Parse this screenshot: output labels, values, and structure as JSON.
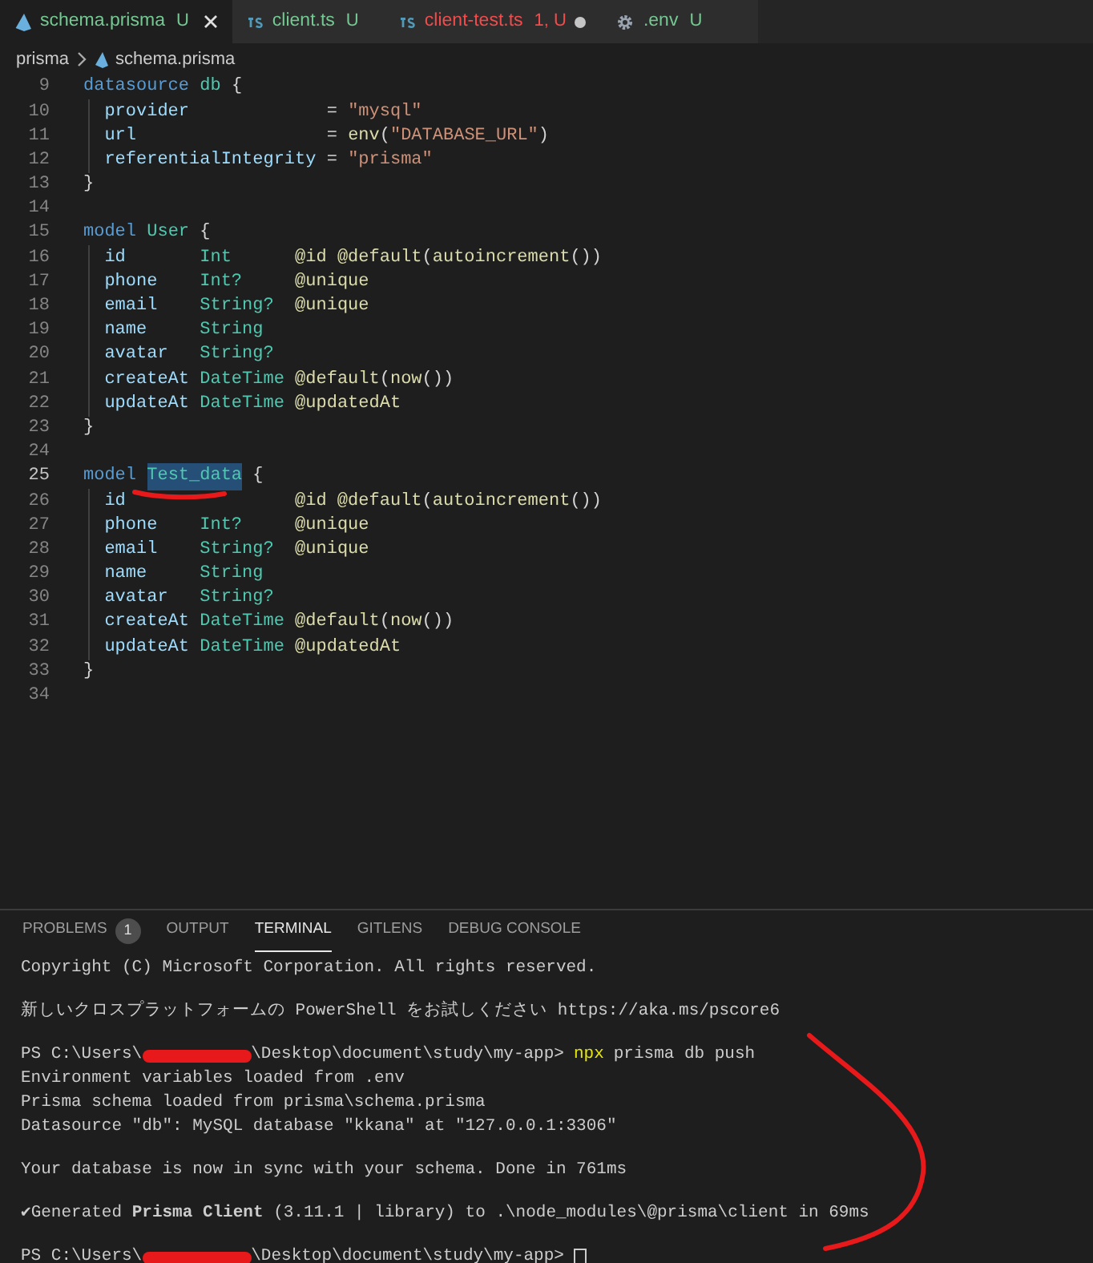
{
  "tabs": [
    {
      "label": "schema.prisma",
      "kind": "prisma",
      "status": "U",
      "color": "#73c991",
      "selected": true,
      "modified": false
    },
    {
      "label": "client.ts",
      "kind": "ts",
      "status": "U",
      "color": "#73c991",
      "selected": false,
      "modified": false
    },
    {
      "label": "client-test.ts",
      "kind": "ts",
      "status": "1, U",
      "color": "#f14c4c",
      "selected": false,
      "modified": true
    },
    {
      "label": ".env",
      "kind": "gear",
      "status": "U",
      "color": "#73c991",
      "selected": false,
      "modified": false
    }
  ],
  "breadcrumb": {
    "folder": "prisma",
    "file": "schema.prisma"
  },
  "editor": {
    "lines": [
      {
        "number": "9",
        "active": false,
        "tokens": [
          {
            "text": "datasource ",
            "kind": "kw"
          },
          {
            "text": "db",
            "kind": "type"
          },
          {
            "text": " {",
            "kind": "punct"
          }
        ]
      },
      {
        "number": "10",
        "active": false,
        "tokens": [
          {
            "text": "  provider",
            "kind": "field"
          },
          {
            "text": "             = ",
            "kind": "plain"
          },
          {
            "text": "\"mysql\"",
            "kind": "str"
          }
        ]
      },
      {
        "number": "11",
        "active": false,
        "tokens": [
          {
            "text": "  url",
            "kind": "field"
          },
          {
            "text": "                  = ",
            "kind": "plain"
          },
          {
            "text": "env",
            "kind": "fn"
          },
          {
            "text": "(",
            "kind": "punct"
          },
          {
            "text": "\"DATABASE_URL\"",
            "kind": "str"
          },
          {
            "text": ")",
            "kind": "punct"
          }
        ]
      },
      {
        "number": "12",
        "active": false,
        "tokens": [
          {
            "text": "  referentialIntegrity",
            "kind": "field"
          },
          {
            "text": " = ",
            "kind": "plain"
          },
          {
            "text": "\"prisma\"",
            "kind": "str"
          }
        ]
      },
      {
        "number": "13",
        "active": false,
        "tokens": [
          {
            "text": "}",
            "kind": "punct"
          }
        ]
      },
      {
        "number": "14",
        "active": false
      },
      {
        "number": "15",
        "active": false,
        "tokens": [
          {
            "text": "model ",
            "kind": "kw"
          },
          {
            "text": "User",
            "kind": "type"
          },
          {
            "text": " {",
            "kind": "punct"
          }
        ]
      },
      {
        "number": "16",
        "active": false,
        "tokens": [
          {
            "text": "  id       ",
            "kind": "field"
          },
          {
            "text": "Int      ",
            "kind": "type"
          },
          {
            "text": "@id @default",
            "kind": "attr"
          },
          {
            "text": "(",
            "kind": "punct"
          },
          {
            "text": "autoincrement",
            "kind": "fn"
          },
          {
            "text": "())",
            "kind": "punct"
          }
        ]
      },
      {
        "number": "17",
        "active": false,
        "tokens": [
          {
            "text": "  phone    ",
            "kind": "field"
          },
          {
            "text": "Int?     ",
            "kind": "type"
          },
          {
            "text": "@unique",
            "kind": "attr"
          }
        ]
      },
      {
        "number": "18",
        "active": false,
        "tokens": [
          {
            "text": "  email    ",
            "kind": "field"
          },
          {
            "text": "String?  ",
            "kind": "type"
          },
          {
            "text": "@unique",
            "kind": "attr"
          }
        ]
      },
      {
        "number": "19",
        "active": false,
        "tokens": [
          {
            "text": "  name     ",
            "kind": "field"
          },
          {
            "text": "String",
            "kind": "type"
          }
        ]
      },
      {
        "number": "20",
        "active": false,
        "tokens": [
          {
            "text": "  avatar   ",
            "kind": "field"
          },
          {
            "text": "String?",
            "kind": "type"
          }
        ]
      },
      {
        "number": "21",
        "active": false,
        "tokens": [
          {
            "text": "  createAt ",
            "kind": "field"
          },
          {
            "text": "DateTime ",
            "kind": "type"
          },
          {
            "text": "@default",
            "kind": "attr"
          },
          {
            "text": "(",
            "kind": "punct"
          },
          {
            "text": "now",
            "kind": "fn"
          },
          {
            "text": "())",
            "kind": "punct"
          }
        ]
      },
      {
        "number": "22",
        "active": false,
        "tokens": [
          {
            "text": "  updateAt ",
            "kind": "field"
          },
          {
            "text": "DateTime ",
            "kind": "type"
          },
          {
            "text": "@updatedAt",
            "kind": "attr"
          }
        ]
      },
      {
        "number": "23",
        "active": false,
        "tokens": [
          {
            "text": "}",
            "kind": "punct"
          }
        ]
      },
      {
        "number": "24",
        "active": false
      },
      {
        "number": "25",
        "active": true,
        "tokens": [
          {
            "text": "model ",
            "kind": "kw"
          },
          {
            "text": "Test_data",
            "kind": "selection"
          },
          {
            "text": " {",
            "kind": "punct"
          }
        ]
      },
      {
        "number": "26",
        "active": false,
        "tokens": [
          {
            "text": "  id                ",
            "kind": "field"
          },
          {
            "text": "@id @default",
            "kind": "attr"
          },
          {
            "text": "(",
            "kind": "punct"
          },
          {
            "text": "autoincrement",
            "kind": "fn"
          },
          {
            "text": "())",
            "kind": "punct"
          }
        ]
      },
      {
        "number": "27",
        "active": false,
        "tokens": [
          {
            "text": "  phone    ",
            "kind": "field"
          },
          {
            "text": "Int?     ",
            "kind": "type"
          },
          {
            "text": "@unique",
            "kind": "attr"
          }
        ]
      },
      {
        "number": "28",
        "active": false,
        "tokens": [
          {
            "text": "  email    ",
            "kind": "field"
          },
          {
            "text": "String?  ",
            "kind": "type"
          },
          {
            "text": "@unique",
            "kind": "attr"
          }
        ]
      },
      {
        "number": "29",
        "active": false,
        "tokens": [
          {
            "text": "  name     ",
            "kind": "field"
          },
          {
            "text": "String",
            "kind": "type"
          }
        ]
      },
      {
        "number": "30",
        "active": false,
        "tokens": [
          {
            "text": "  avatar   ",
            "kind": "field"
          },
          {
            "text": "String?",
            "kind": "type"
          }
        ]
      },
      {
        "number": "31",
        "active": false,
        "tokens": [
          {
            "text": "  createAt ",
            "kind": "field"
          },
          {
            "text": "DateTime ",
            "kind": "type"
          },
          {
            "text": "@default",
            "kind": "attr"
          },
          {
            "text": "(",
            "kind": "punct"
          },
          {
            "text": "now",
            "kind": "fn"
          },
          {
            "text": "())",
            "kind": "punct"
          }
        ]
      },
      {
        "number": "32",
        "active": false,
        "tokens": [
          {
            "text": "  updateAt ",
            "kind": "field"
          },
          {
            "text": "DateTime ",
            "kind": "type"
          },
          {
            "text": "@updatedAt",
            "kind": "attr"
          }
        ]
      },
      {
        "number": "33",
        "active": false,
        "tokens": [
          {
            "text": "}",
            "kind": "punct"
          }
        ]
      },
      {
        "number": "34",
        "active": false
      }
    ]
  },
  "panel": {
    "tabs": [
      {
        "label": "PROBLEMS",
        "badge": "1",
        "selected": false
      },
      {
        "label": "OUTPUT",
        "selected": false
      },
      {
        "label": "TERMINAL",
        "selected": true
      },
      {
        "label": "GITLENS",
        "selected": false
      },
      {
        "label": "DEBUG CONSOLE",
        "selected": false
      }
    ],
    "terminal": [
      {
        "kind": "text",
        "text": "Copyright (C) Microsoft Corporation. All rights reserved."
      },
      {
        "kind": "blank"
      },
      {
        "kind": "text",
        "text": "新しいクロスプラットフォームの PowerShell をお試しください https://aka.ms/pscore6"
      },
      {
        "kind": "blank"
      },
      {
        "kind": "prompt",
        "prefix": "PS C:\\Users\\",
        "suffix": "\\Desktop\\document\\study\\my-app>",
        "command": "npx",
        "args": "prisma db push",
        "cursor": false
      },
      {
        "kind": "text",
        "text": "Environment variables loaded from .env"
      },
      {
        "kind": "text",
        "text": "Prisma schema loaded from prisma\\schema.prisma"
      },
      {
        "kind": "text",
        "text": "Datasource \"db\": MySQL database \"kkana\" at \"127.0.0.1:3306\""
      },
      {
        "kind": "blank"
      },
      {
        "kind": "text",
        "text": "Your database is now in sync with your schema. Done in 761ms"
      },
      {
        "kind": "blank"
      },
      {
        "kind": "text",
        "text": "✔Generated **Prisma Client** (3.11.1 | library) to .\\node_modules\\@prisma\\client in 69ms"
      },
      {
        "kind": "blank"
      },
      {
        "kind": "prompt",
        "prefix": "PS C:\\Users\\",
        "suffix": "\\Desktop\\document\\study\\my-app>",
        "cursor": true
      }
    ]
  }
}
